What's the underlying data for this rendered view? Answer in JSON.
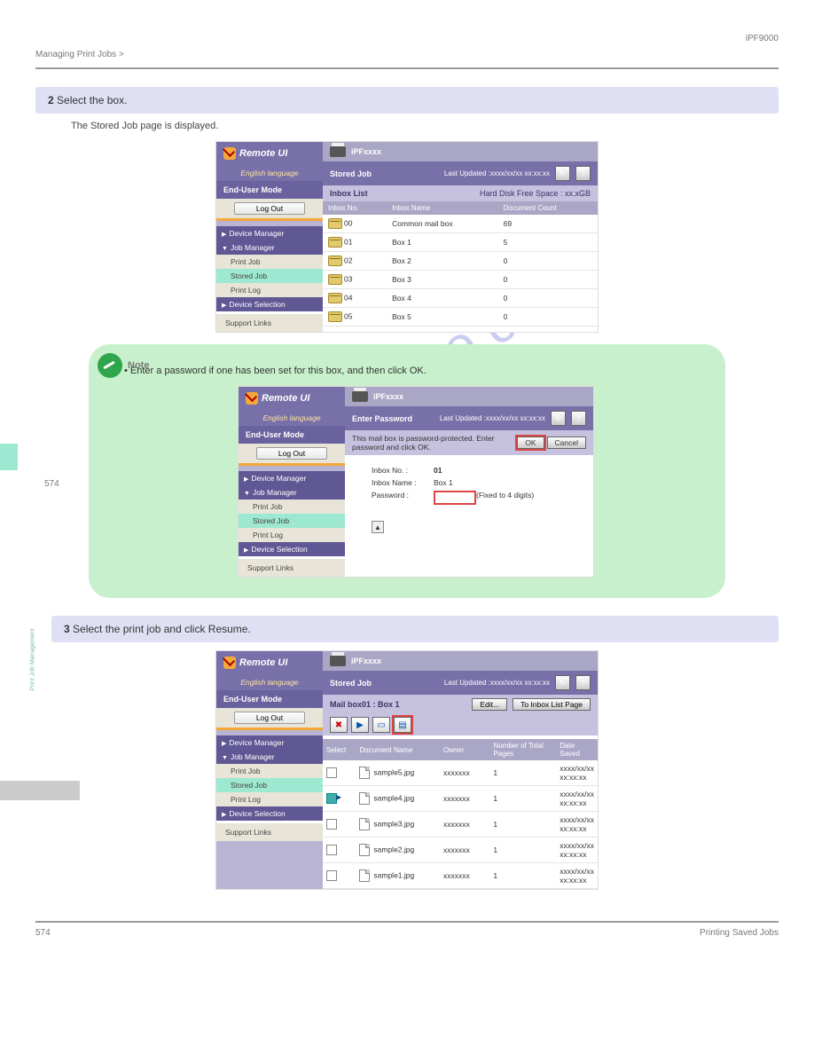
{
  "docHeader": {
    "right": "iPF9000",
    "left": "Managing Print Jobs >"
  },
  "sidelabel": "Print Job Management",
  "page": "574",
  "footer": {
    "left": "574",
    "right": "Printing Saved Jobs"
  },
  "step2": {
    "label": "2",
    "text": "Select the box."
  },
  "step2sub": "The Stored Job page is displayed.",
  "step3": {
    "label": "3",
    "text": "Select the print job and click Resume."
  },
  "screenshot1": {
    "logo": "Remote UI",
    "lang": "English language",
    "mode": "End-User Mode",
    "logout": "Log Out",
    "menu": {
      "device": "Device Manager",
      "job": "Job Manager",
      "jobs": [
        "Print Job",
        "Stored Job",
        "Print Log"
      ],
      "selection": "Device Selection",
      "support": "Support Links"
    },
    "device": "iPFxxxx",
    "title": "Stored Job",
    "updated": "Last Updated :xxxx/xx/xx xx:xx:xx",
    "inboxList": "Inbox List",
    "freeSpace": "Hard Disk Free Space : xx.xGB",
    "cols": [
      "Inbox No.",
      "Inbox Name",
      "Document Count"
    ],
    "rows": [
      {
        "no": "00",
        "name": "Common mail box",
        "count": "69"
      },
      {
        "no": "01",
        "name": "Box 1",
        "count": "5"
      },
      {
        "no": "02",
        "name": "Box 2",
        "count": "0"
      },
      {
        "no": "03",
        "name": "Box 3",
        "count": "0"
      },
      {
        "no": "04",
        "name": "Box 4",
        "count": "0"
      },
      {
        "no": "05",
        "name": "Box 5",
        "count": "0"
      }
    ]
  },
  "note": {
    "title": "Note",
    "item1": "Enter a password if one has been set for this box, and then click OK.",
    "screenshot": {
      "title": "Enter Password",
      "msg": "This mail box is password-protected. Enter password and click OK.",
      "ok": "OK",
      "cancel": "Cancel",
      "fields": {
        "no": "Inbox No. :",
        "noVal": "01",
        "name": "Inbox Name :",
        "nameVal": "Box 1",
        "pw": "Password :",
        "hint": "(Fixed to 4 digits)"
      }
    }
  },
  "screenshot3": {
    "title": "Stored Job",
    "mailTitle": "Mail box01 : Box 1",
    "edit": "Edit...",
    "toInbox": "To Inbox List Page",
    "cols": [
      "Select",
      "Document Name",
      "Owner",
      "Number of Total Pages",
      "Date Saved"
    ],
    "rows": [
      {
        "sel": false,
        "name": "sample5.jpg",
        "owner": "xxxxxxx",
        "pages": "1",
        "date": "xxxx/xx/xx xx:xx:xx"
      },
      {
        "sel": true,
        "name": "sample4.jpg",
        "owner": "xxxxxxx",
        "pages": "1",
        "date": "xxxx/xx/xx xx:xx:xx"
      },
      {
        "sel": false,
        "name": "sample3.jpg",
        "owner": "xxxxxxx",
        "pages": "1",
        "date": "xxxx/xx/xx xx:xx:xx"
      },
      {
        "sel": false,
        "name": "sample2.jpg",
        "owner": "xxxxxxx",
        "pages": "1",
        "date": "xxxx/xx/xx xx:xx:xx"
      },
      {
        "sel": false,
        "name": "sample1.jpg",
        "owner": "xxxxxxx",
        "pages": "1",
        "date": "xxxx/xx/xx xx:xx:xx"
      }
    ]
  },
  "watermark": "manualshive.com"
}
